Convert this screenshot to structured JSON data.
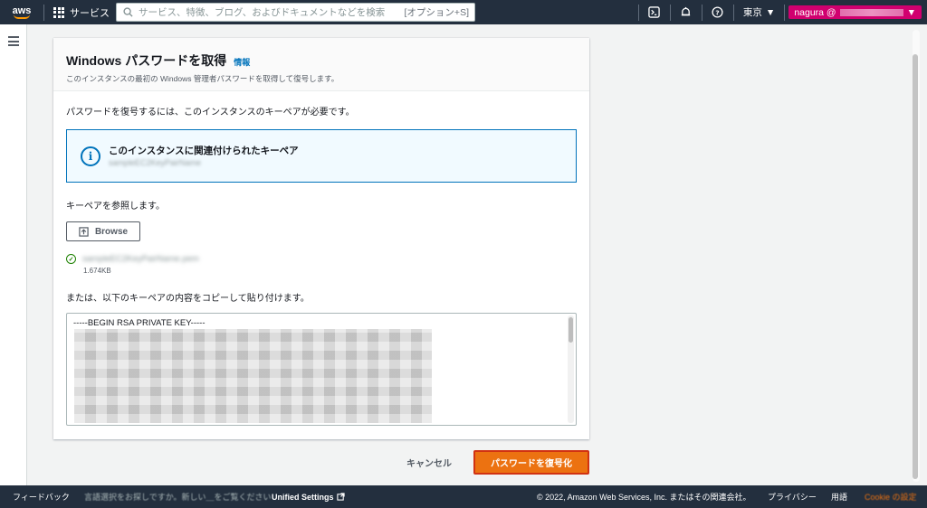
{
  "nav": {
    "logo": "aws",
    "services": "サービス",
    "search_placeholder": "サービス、特徴、ブログ、およびドキュメントなどを検索",
    "search_shortcut": "[オプション+S]",
    "region": "東京",
    "account": "nagura @"
  },
  "card": {
    "title": "Windows パスワードを取得",
    "info": "情報",
    "description": "このインスタンスの最初の Windows 管理者パスワードを取得して復号します。",
    "required_text": "パスワードを復号するには、このインスタンスのキーペアが必要です。",
    "alert_title": "このインスタンスに関連付けられたキーペア",
    "alert_keyname": "sampleEC2KeyPairName",
    "browse_label": "キーペアを参照します。",
    "browse_button": "Browse",
    "file_name": "sampleEC2KeyPairName.pem",
    "file_size": "1.674KB",
    "paste_label": "または、以下のキーペアの内容をコピーして貼り付けます。",
    "key_first_line": "-----BEGIN RSA PRIVATE KEY-----"
  },
  "actions": {
    "cancel": "キャンセル",
    "decrypt": "パスワードを復号化"
  },
  "footer": {
    "feedback": "フィードバック",
    "language_prompt": "言語選択をお探しですか。新しい＿をご覧ください",
    "unified_settings": "Unified Settings",
    "copyright": "© 2022, Amazon Web Services, Inc. またはその関連会社。",
    "privacy": "プライバシー",
    "terms": "用語",
    "cookie": "Cookie の設定"
  },
  "colors": {
    "nav_bg": "#232f3e",
    "primary_button": "#ec7211",
    "link": "#0073bb",
    "account_badge": "#d1006f",
    "success": "#1d8102"
  }
}
